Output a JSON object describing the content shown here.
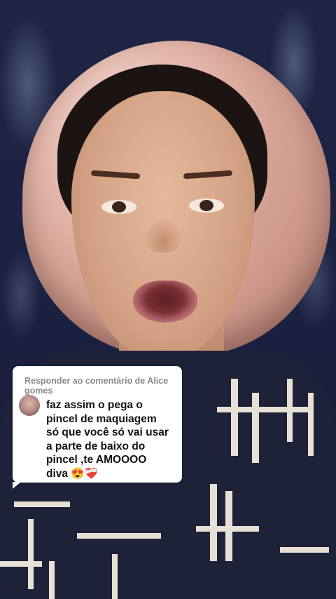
{
  "comment_reply": {
    "header": "Responder ao comentário de Alice gomes",
    "text": "faz assim o pega o\npincel de maquiagem\nsó que você só vai usar\na parte de baixo do\npincel ,te AMOOOO\ndiva 😍❤️‍🩹"
  },
  "colors": {
    "card_bg": "#ffffff",
    "header_text": "#8a8a8a",
    "body_text": "#111111"
  }
}
